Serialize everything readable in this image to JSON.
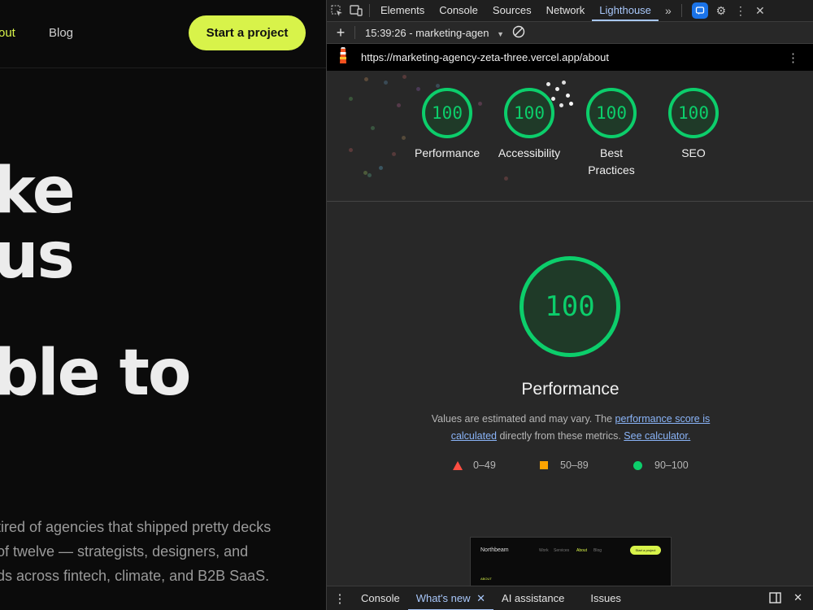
{
  "site": {
    "nav": {
      "about_partial": "out",
      "blog": "Blog",
      "cta": "Start a project"
    },
    "hero": [
      "ke",
      "us",
      "ble to"
    ],
    "body": [
      "tired of agencies that shipped pretty decks",
      " of twelve — strategists, designers, and",
      "ds across fintech, climate, and B2B SaaS."
    ]
  },
  "devtools": {
    "tabs": [
      "Elements",
      "Console",
      "Sources",
      "Network",
      "Lighthouse"
    ],
    "active_tab": "Lighthouse",
    "toolbar": {
      "report_label": "15:39:26 - marketing-agen"
    },
    "url": "https://marketing-agency-zeta-three.vercel.app/about",
    "scores": [
      {
        "value": "100",
        "label": "Performance"
      },
      {
        "value": "100",
        "label": "Accessibility"
      },
      {
        "value": "100",
        "label": "Best Practices"
      },
      {
        "value": "100",
        "label": "SEO"
      }
    ],
    "performance": {
      "score": "100",
      "title": "Performance",
      "desc_pre": "Values are estimated and may vary. The ",
      "link1": "performance score is calculated",
      "desc_mid": " directly from these metrics. ",
      "link2": "See calculator."
    },
    "legend": [
      {
        "range": "0–49",
        "color": "#ff4e42"
      },
      {
        "range": "50–89",
        "color": "#ffa400"
      },
      {
        "range": "90–100",
        "color": "#0cce6b"
      }
    ],
    "thumbnail": {
      "brand": "Northbeam",
      "links": [
        "Work",
        "Services",
        "About",
        "Blog"
      ],
      "cta": "Start a project",
      "section": "ABOUT"
    },
    "drawer": {
      "tabs": [
        "Console",
        "What's new",
        "AI assistance",
        "Issues"
      ],
      "active": "What's new"
    }
  }
}
